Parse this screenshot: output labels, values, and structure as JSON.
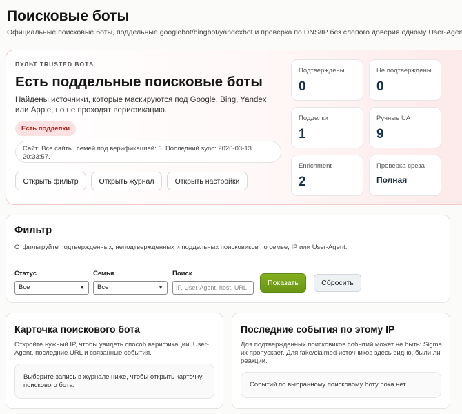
{
  "page": {
    "title": "Поисковые боты",
    "subtitle": "Официальные поисковые боты, поддельные googlebot/bingbot/yandexbot и проверка по DNS/IP без слепого доверия одному User-Agent."
  },
  "trusted": {
    "eyebrow": "ПУЛЬТ TRUSTED BOTS",
    "title": "Есть поддельные поисковые боты",
    "description": "Найдены источники, которые маскируются под Google, Bing, Yandex или Apple, но не проходят верификацию.",
    "badge": "Есть подделки",
    "sync_info": "Сайт: Все сайты, семей под верификацией: 6. Последний sync: 2026-03-13 20:33:57.",
    "buttons": {
      "open_filter": "Открыть фильтр",
      "open_journal": "Открыть журнал",
      "open_settings": "Открыть настройки"
    },
    "stats": [
      {
        "label": "Подтверждены",
        "value": "0"
      },
      {
        "label": "Не подтверждены",
        "value": "0"
      },
      {
        "label": "Подделки",
        "value": "1"
      },
      {
        "label": "Ручные UA",
        "value": "9"
      },
      {
        "label": "Enrichment",
        "value": "2"
      },
      {
        "label": "Проверка среза",
        "value": "Полная"
      }
    ]
  },
  "filter": {
    "title": "Фильтр",
    "description": "Отфильтруйте подтвержденных, неподтвержденных и поддельных поисковиков по семье, IP или User-Agent.",
    "status_label": "Статус",
    "status_value": "Все",
    "family_label": "Семья",
    "family_value": "Все",
    "search_label": "Поиск",
    "search_placeholder": "IP, User-Agent, host, URL",
    "apply_label": "Показать",
    "reset_label": "Сбросить"
  },
  "bot_card": {
    "title": "Карточка поискового бота",
    "description": "Откройте нужный IP, чтобы увидеть способ верификации, User-Agent, последние URL и связанные события.",
    "empty": "Выберите запись в журнале ниже, чтобы открыть карточку поискового бота."
  },
  "events_card": {
    "title": "Последние события по этому IP",
    "description": "Для подтвержденных поисковиков событий может не быть: Sigma их пропускает. Для fake/claimed источников здесь видно, были ли реакции.",
    "empty": "Событий по выбранному поисковому боту пока нет."
  }
}
